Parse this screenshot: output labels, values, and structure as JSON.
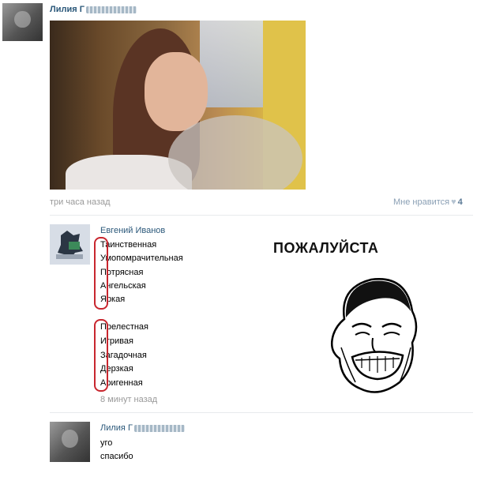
{
  "post": {
    "author": "Лилия Г",
    "time": "три часа назад",
    "like_label": "Мне нравится",
    "like_count": "4"
  },
  "comment": {
    "author": "Евгений Иванов",
    "lines_group1": [
      "Таинственная",
      "Умопомрачительная",
      "Потрясная",
      "Ангельская",
      "Яркая"
    ],
    "lines_group2": [
      "Прелестная",
      "Игривая",
      "Загадочная",
      "Дерзкая",
      "Аригенная"
    ],
    "time": "8 минут назад",
    "meme_caption": "ПОЖАЛУЙСТА",
    "meme_icon": "yao-ming-meme-face",
    "highlight_color": "#c8262e"
  },
  "reply": {
    "author": "Лилия Г",
    "line1": "уго",
    "line2": "спасибо"
  }
}
